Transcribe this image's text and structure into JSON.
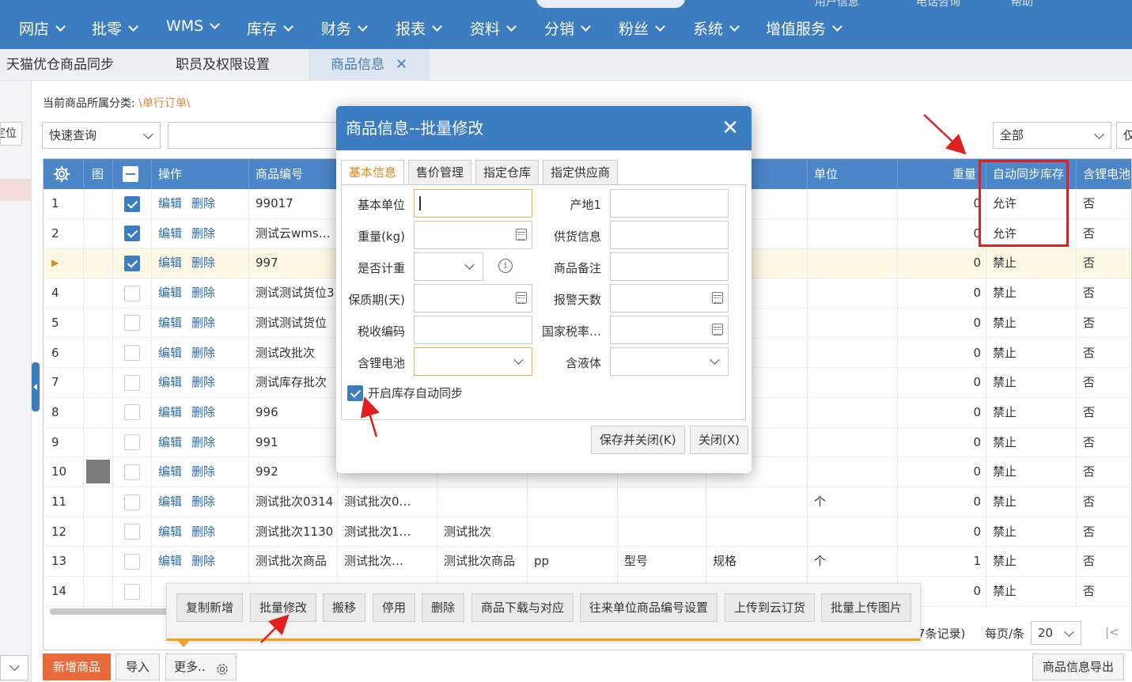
{
  "topbar": {
    "right_items": [
      "用户信息",
      "电话咨询",
      "帮助"
    ],
    "menu": [
      "网店",
      "批零",
      "WMS",
      "库存",
      "财务",
      "报表",
      "资料",
      "分销",
      "粉丝",
      "系统",
      "增值服务"
    ]
  },
  "tabs": [
    {
      "label": "天猫优仓商品同步"
    },
    {
      "label": "职员及权限设置"
    },
    {
      "label": "商品信息",
      "close": "✕"
    }
  ],
  "left": {
    "locate": "定位"
  },
  "category": {
    "label": "当前商品所属分类:",
    "value": "\\单行订单\\"
  },
  "filters": {
    "quick": "快速查询",
    "right_select": "全部",
    "right_btn": "仅"
  },
  "grid": {
    "headers": {
      "img": "图",
      "op": "操作",
      "code": "商品编号",
      "unit": "单位",
      "weight": "重量",
      "autosync": "自动同步库存",
      "battery": "含锂电池"
    },
    "edit": "编辑",
    "delete": "删除",
    "rows": [
      {
        "no": "1",
        "checked": true,
        "code": "99017",
        "c2": "",
        "c3": "",
        "c4": "",
        "c5": "",
        "c6": "",
        "unit": "",
        "weight": "0",
        "sync": "允许",
        "bat": "否"
      },
      {
        "no": "2",
        "checked": true,
        "code": "测试云wms…",
        "c2": "",
        "c3": "",
        "c4": "",
        "c5": "",
        "c6": "",
        "unit": "",
        "weight": "0",
        "sync": "允许",
        "bat": "否"
      },
      {
        "no": "▶",
        "checked": true,
        "code": "997",
        "c2": "",
        "c3": "",
        "c4": "",
        "c5": "",
        "c6": "",
        "unit": "",
        "weight": "0",
        "sync": "禁止",
        "bat": "否"
      },
      {
        "no": "4",
        "checked": false,
        "code": "测试测试货位3",
        "c2": "",
        "c3": "",
        "c4": "",
        "c5": "",
        "c6": "",
        "unit": "",
        "weight": "0",
        "sync": "禁止",
        "bat": "否"
      },
      {
        "no": "5",
        "checked": false,
        "code": "测试测试货位",
        "c2": "",
        "c3": "",
        "c4": "",
        "c5": "",
        "c6": "",
        "unit": "",
        "weight": "0",
        "sync": "禁止",
        "bat": "否"
      },
      {
        "no": "6",
        "checked": false,
        "code": "测试改批次",
        "c2": "",
        "c3": "",
        "c4": "",
        "c5": "",
        "c6": "",
        "unit": "",
        "weight": "0",
        "sync": "禁止",
        "bat": "否"
      },
      {
        "no": "7",
        "checked": false,
        "code": "测试库存批次",
        "c2": "",
        "c3": "",
        "c4": "",
        "c5": "",
        "c6": "",
        "unit": "",
        "weight": "0",
        "sync": "禁止",
        "bat": "否"
      },
      {
        "no": "8",
        "checked": false,
        "code": "996",
        "c2": "",
        "c3": "",
        "c4": "",
        "c5": "",
        "c6": "",
        "unit": "",
        "weight": "0",
        "sync": "禁止",
        "bat": "否"
      },
      {
        "no": "9",
        "checked": false,
        "code": "991",
        "c2": "",
        "c3": "",
        "c4": "",
        "c5": "",
        "c6": "",
        "unit": "",
        "weight": "0",
        "sync": "禁止",
        "bat": "否"
      },
      {
        "no": "10",
        "checked": false,
        "img": true,
        "code": "992",
        "c2": "",
        "c3": "",
        "c4": "",
        "c5": "",
        "c6": "",
        "unit": "",
        "weight": "0",
        "sync": "禁止",
        "bat": "否"
      },
      {
        "no": "11",
        "checked": false,
        "code": "测试批次0314",
        "c2": "测试批次0…",
        "c3": "",
        "c4": "",
        "c5": "",
        "c6": "",
        "unit": "个",
        "weight": "0",
        "sync": "禁止",
        "bat": "否"
      },
      {
        "no": "12",
        "checked": false,
        "code": "测试批次1130",
        "c2": "测试批次1…",
        "c3": "测试批次",
        "c4": "",
        "c5": "",
        "c6": "",
        "unit": "",
        "weight": "0",
        "sync": "禁止",
        "bat": "否"
      },
      {
        "no": "13",
        "checked": false,
        "code": "测试批次商品",
        "c2": "测试批次…",
        "c3": "测试批次商品",
        "c4": "pp",
        "c5": "型号",
        "c6": "规格",
        "unit": "个",
        "weight": "1",
        "sync": "禁止",
        "bat": "否"
      },
      {
        "no": "14",
        "checked": false,
        "code": "",
        "c2": "",
        "c3": "",
        "c4": "",
        "c5": "",
        "c6": "",
        "unit": "",
        "weight": "0",
        "sync": "禁止",
        "bat": "否"
      }
    ]
  },
  "pager": {
    "records": "7条记录)",
    "per_page_label": "每页/条",
    "per_page": "20",
    "first": "|<"
  },
  "bottom": {
    "add": "新增商品",
    "import": "导入",
    "more": "更多..",
    "export": "商品信息导出"
  },
  "more_popup": [
    "复制新增",
    "批量修改",
    "搬移",
    "停用",
    "删除",
    "商品下载与对应",
    "往来单位商品编号设置",
    "上传到云订货",
    "批量上传图片"
  ],
  "modal": {
    "title": "商品信息--批量修改",
    "close": "✕",
    "tabs": [
      "基本信息",
      "售价管理",
      "指定仓库",
      "指定供应商"
    ],
    "fields": {
      "base_unit": "基本单位",
      "origin": "产地1",
      "weight": "重量(kg)",
      "supply": "供货信息",
      "weighing": "是否计重",
      "remark": "商品备注",
      "shelf_life": "保质期(天)",
      "alarm_days": "报警天数",
      "tax_code": "税收编码",
      "tax_rate": "国家税率…",
      "battery": "含锂电池",
      "liquid": "含液体"
    },
    "sync_checkbox": {
      "label": "开启库存自动同步",
      "checked": true
    },
    "save_close": "保存并关闭(K)",
    "close_btn": "关闭(X)"
  }
}
